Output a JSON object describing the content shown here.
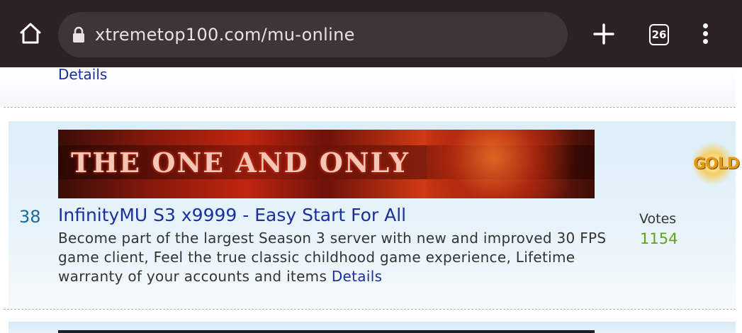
{
  "browser": {
    "url": "xtremetop100.com/mu-online",
    "tab_count": "26"
  },
  "previous_entry": {
    "details_link": "Details"
  },
  "server": {
    "rank": "38",
    "banner_text": "THE ONE AND ONLY",
    "title": "InfinityMU S3 x9999 - Easy Start For All",
    "description": "Become part of the largest Season 3 server with new and improved 30 FPS game client, Feel the true classic childhood game experience, Lifetime warranty of your accounts and items",
    "details_link": "Details",
    "votes_label": "Votes",
    "votes_count": "1154"
  },
  "side_ad": {
    "text": "GOLD"
  },
  "colors": {
    "chrome_bg": "#2b2221",
    "urlbar_bg": "#3f3534",
    "link": "#1a2ea0",
    "votes": "#62a21b",
    "rank": "#1a6a9a"
  }
}
